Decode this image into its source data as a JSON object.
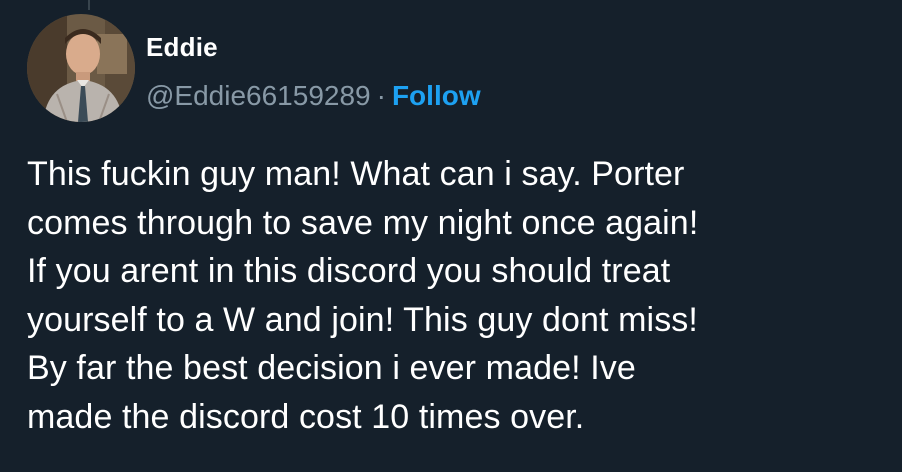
{
  "tweet": {
    "author": {
      "display_name": "Eddie",
      "handle": "@Eddie66159289"
    },
    "separator": "·",
    "follow_label": "Follow",
    "text": "This fuckin guy man! What can i say. Porter\ncomes through to save my night once again!\nIf you arent in this discord you should treat\nyourself to a W and join! This guy dont miss!\nBy far the best decision i ever made! Ive\nmade the discord cost 10 times over."
  },
  "colors": {
    "background": "#15202b",
    "primary_text": "#ffffff",
    "secondary_text": "#8899a6",
    "accent": "#1da1f2"
  }
}
